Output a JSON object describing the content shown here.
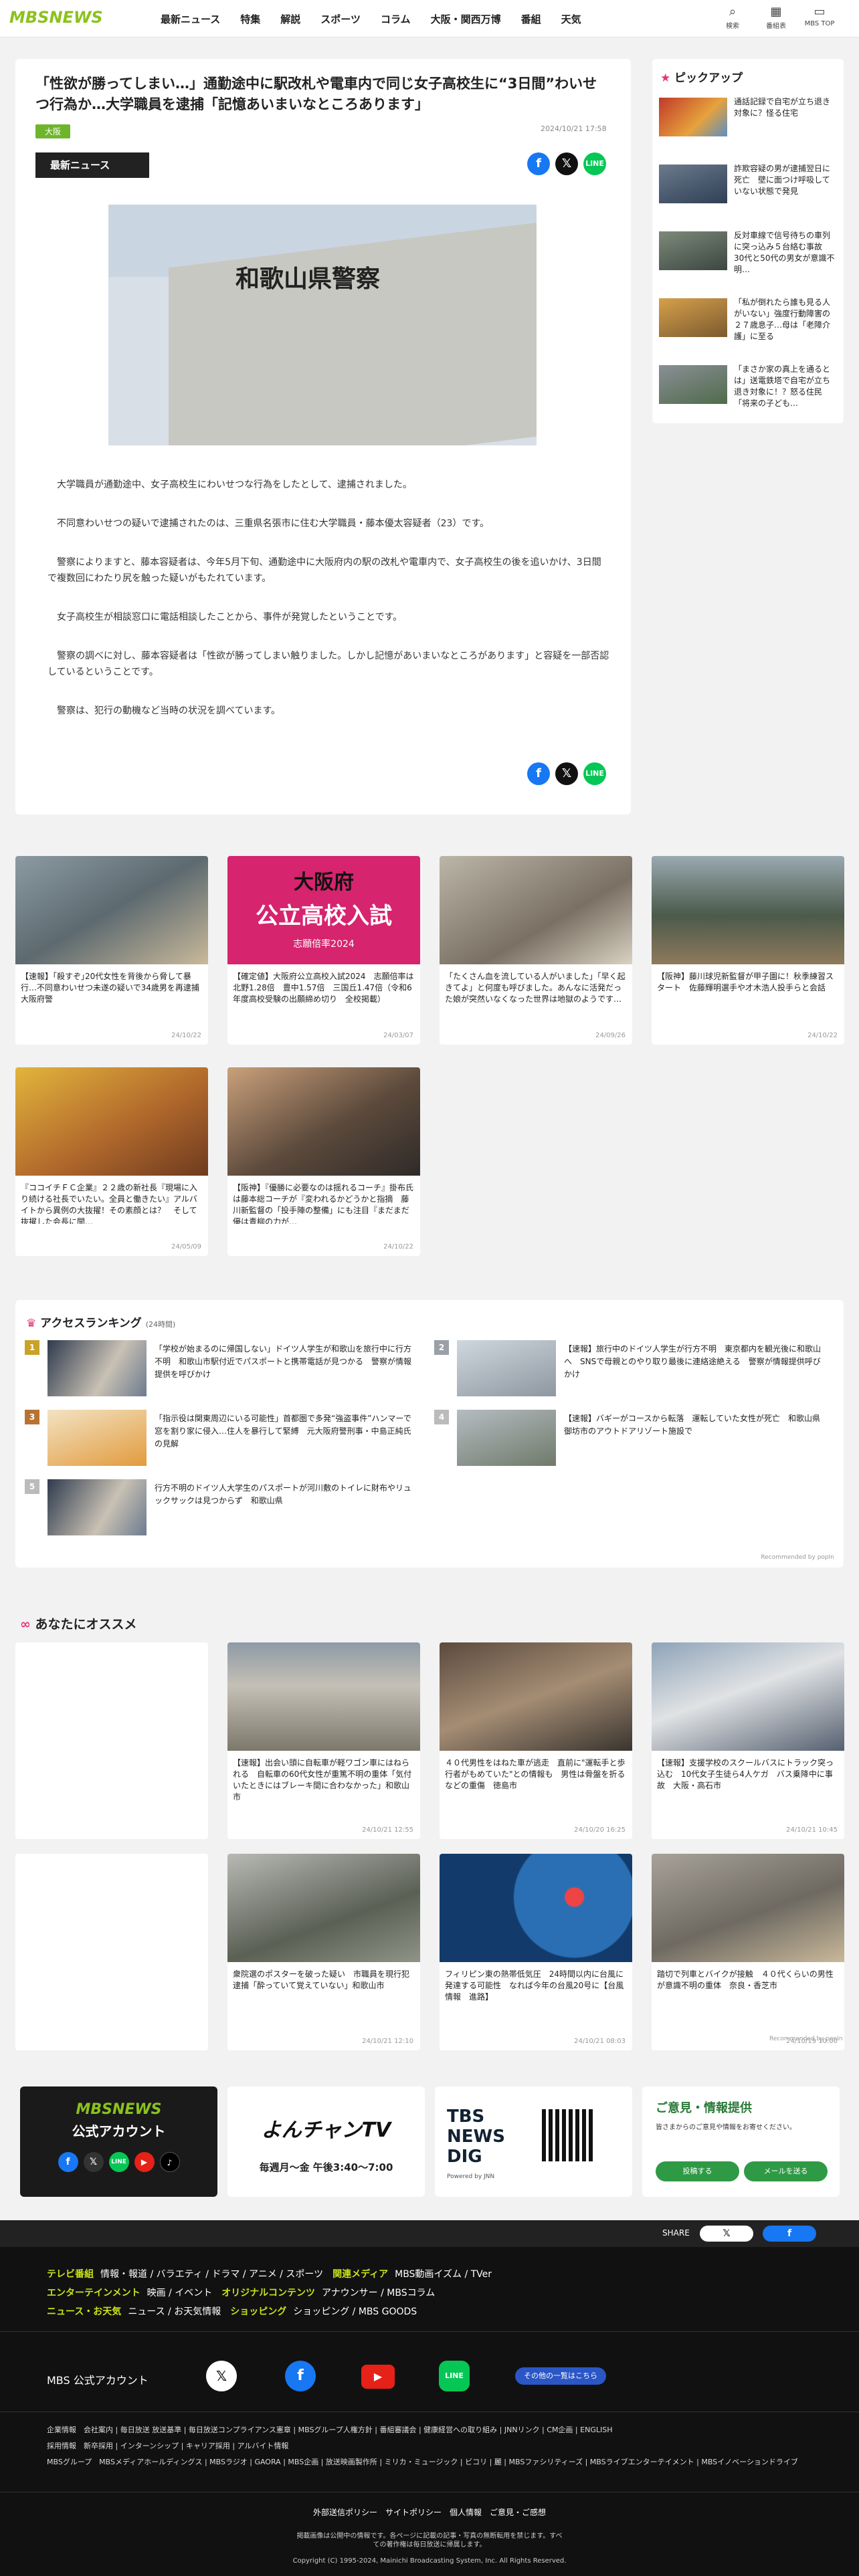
{
  "header": {
    "logo": "MBSNEWS",
    "nav": [
      "最新ニュース",
      "特集",
      "解説",
      "スポーツ",
      "コラム",
      "大阪・関西万博",
      "番組",
      "天気"
    ],
    "icons": [
      {
        "label": "検索",
        "icon": "search-icon"
      },
      {
        "label": "番組表",
        "icon": "calendar-icon"
      },
      {
        "label": "MBS TOP",
        "icon": "tv-icon"
      }
    ]
  },
  "article": {
    "title": "「性欲が勝ってしまい…」通勤途中に駅改札や電車内で同じ女子高校生に“3日間”わいせつ行為か…大学職員を逮捕「記憶あいまいなところあります」",
    "tag": "大阪",
    "date": "2024/10/21 17:58",
    "badge": "最新ニュース",
    "sign": "和歌山県警察",
    "paragraphs": [
      "大学職員が通勤途中、女子高校生にわいせつな行為をしたとして、逮捕されました。",
      "不同意わいせつの疑いで逮捕されたのは、三重県名張市に住む大学職員・藤本優太容疑者（23）です。",
      "警察によりますと、藤本容疑者は、今年5月下旬、通勤途中に大阪府内の駅の改札や電車内で、女子高校生の後を追いかけ、3日間で複数回にわたり尻を触った疑いがもたれています。",
      "女子高校生が相談窓口に電話相談したことから、事件が発覚したということです。",
      "警察の調べに対し、藤本容疑者は「性欲が勝ってしまい触りました。しかし記憶があいまいなところがあります」と容疑を一部否認しているということです。",
      "警察は、犯行の動機など当時の状況を調べています。"
    ]
  },
  "pickup": {
    "title": "ピックアップ",
    "items": [
      "通話記録で自宅が立ち退き対象に？怪る住宅",
      "詐欺容疑の男が逮捕翌日に死亡　壁に面つけ呼吸していない状態で発見",
      "反対車線で信号待ちの車列に突っ込み５台絡む事故　30代と50代の男女が意識不明…",
      "「私が倒れたら誰も見る人がいない」強度行動障害の２７歳息子…母は「老障介護」に至る",
      "「まさか家の真上を通るとは」送電鉄塔で自宅が立ち退き対象に！？怒る住民「将来の子ども…"
    ]
  },
  "grid": [
    {
      "text": "【速報】｢殺すぞ｣20代女性を背後から脅して暴行…不同意わいせつ未遂の疑いで34歳男を再逮捕　大阪府警",
      "date": "24/10/22"
    },
    {
      "text": "【確定値】大阪府公立高校入試2024　志願倍率は北野1.28倍　豊中1.57倍　三国丘1.47倍（令和6年度高校受験の出願締め切り　全校掲載）",
      "date": "24/03/07",
      "bigtitle": "大阪府",
      "bigsub": "公立高校入試",
      "bigfoot": "志願倍率2024"
    },
    {
      "text": "「たくさん血を流している人がいました」「早く起きてよ」と何度も呼びました。あんなに活発だった娘が突然いなくなった世界は地獄のようです…",
      "date": "24/09/26"
    },
    {
      "text": "【阪神】藤川球児新監督が甲子園に！秋季練習スタート　佐藤輝明選手や才木浩人投手らと会話",
      "date": "24/10/22"
    },
    {
      "text": "『ココイチＦＣ企業』２２歳の新社長『現場に入り続ける社長でいたい。全員と働きたい』アルバイトから異例の大抜擢！その素顔とは？　そして抜擢した会長に聞…",
      "date": "24/05/09"
    },
    {
      "text": "【阪神】『優勝に必要なのは揺れるコーチ』掛布氏は藤本総コーチが『変われるかどうかと指摘　藤川新監督の「投手陣の整備」にも注目『まだまだ優は青柳の力が…",
      "date": "24/10/22"
    }
  ],
  "ranking": {
    "title": "アクセスランキング",
    "sub": "(24時間)",
    "items": [
      "「学校が始まるのに帰国しない」ドイツ人学生が和歌山を旅行中に行方不明　和歌山市駅付近でパスポートと携帯電話が見つかる　警察が情報提供を呼びかけ",
      "【速報】旅行中のドイツ人学生が行方不明　東京都内を観光後に和歌山へ　SNSで母親とのやり取り最後に連絡途絶える　警察が情報提供呼びかけ",
      "「指示役は関東周辺にいる可能性」首都圏で多発“強盗事件”ハンマーで窓を割り家に侵入…住人を暴行して緊縛　元大阪府警刑事・中島正純氏の見解",
      "【速報】バギーがコースから転落　運転していた女性が死亡　和歌山県御坊市のアウトドアリゾート施設で",
      "行方不明のドイツ人大学生のパスポートが河川敷のトイレに財布やリュックサックは見つからず　和歌山県"
    ],
    "credit": "Recommended by popIn"
  },
  "reco": {
    "title": "あなたにオススメ",
    "items": [
      {
        "text": "【速報】出会い頭に自転車が軽ワゴン車にはねられる　自転車の60代女性が重篤不明の重体「気付いたときにはブレーキ間に合わなかった」和歌山市",
        "date": "24/10/21 12:55"
      },
      {
        "text": "４０代男性をはねた車が逃走　直前に\"運転手と歩行者がもめていた\"との情報も　男性は骨盤を折るなどの重傷　徳島市",
        "date": "24/10/20 16:25"
      },
      {
        "text": "【速報】支援学校のスクールバスにトラック突っ込む　10代女子生徒ら4人ケガ　バス乗降中に事故　大阪・高石市",
        "date": "24/10/21 10:45"
      },
      {
        "text": "衆院選のポスターを破った疑い　市職員を現行犯逮捕「酔っていて覚えていない」和歌山市",
        "date": "24/10/21 12:10"
      },
      {
        "text": "フィリピン東の熱帯低気圧　24時間以内に台風に発達する可能性　なれば今年の台風20号に【台風情報　進路】",
        "date": "24/10/21 08:03"
      },
      {
        "text": "踏切で列車とバイクが接触　４０代くらいの男性が意識不明の重体　奈良・香芝市",
        "date": "24/10/19 10:00"
      }
    ],
    "credit": "Recommended by popIn"
  },
  "banners": {
    "account": "MBSNEWS",
    "account_sub": "公式アカウント",
    "yonchan": "よんチャンTV",
    "yon_time": "毎週月～金 午後3:40～7:00",
    "tbs": "TBS NEWS DIG",
    "tbs_sub": "Powered by JNN",
    "opinion": "ご意見・情報提供",
    "opinion_sub": "皆さまからのご意見や情報をお寄せください。",
    "btn1": "投稿する",
    "btn2": "メールを送る"
  },
  "footer": {
    "share": "SHARE",
    "rows": [
      {
        "h": "テレビ番組",
        "items": "情報・報道 / バラエティ / ドラマ / アニメ / スポーツ",
        "h2": "関連メディア",
        "items2": "MBS動画イズム / TVer"
      },
      {
        "h": "エンターテインメント",
        "items": "映画 / イベント",
        "h2": "オリジナルコンテンツ",
        "items2": "アナウンサー / MBSコラム"
      },
      {
        "h": "ニュース・お天気",
        "items": "ニュース / お天気情報",
        "h2": "ショッピング",
        "items2": "ショッピング / MBS GOODS"
      }
    ],
    "official": "MBS 公式アカウント",
    "others": "その他の一覧はこちら",
    "corp": "企業情報　会社案内 | 毎日放送 放送基準 | 毎日放送コンプライアンス憲章 | MBSグループ人権方針 | 番組審議会 | 健康経営への取り組み | JNNリンク | CM企画 | ENGLISH",
    "recruit": "採用情報　新卒採用 | インターンシップ | キャリア採用 | アルバイト情報",
    "group": "MBSグループ　MBSメディアホールディングス | MBSラジオ | GAORA | MBS企画 | 放送映画製作所 | ミリカ・ミュージック | ビコリ | 麗 | MBSファシリティーズ | MBSライブエンターテイメント | MBSイノベーションドライブ",
    "links": "外部送信ポリシー　サイトポリシー　個人情報　ご意見・ご感想",
    "notice": "掲載画像は公開中の情報です。各ページに記載の記事・写真の無断転用を禁じます。すべての著作権は毎日放送に帰属します。",
    "copy": "Copyright (C) 1995-2024, Mainichi Broadcasting System, Inc. All Rights Reserved."
  },
  "colors": {
    "brand": "#8bc21c",
    "tag": "#6fb52c",
    "footer_h": "#c8e11b"
  }
}
